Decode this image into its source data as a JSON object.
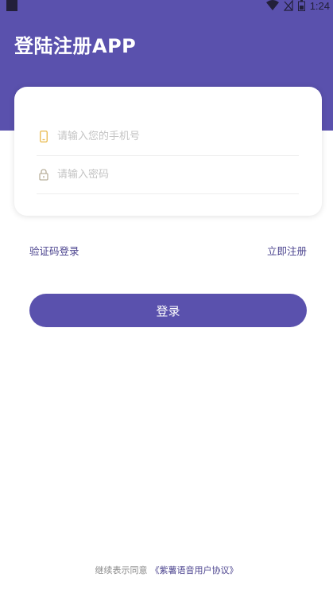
{
  "status_bar": {
    "time": "1:24",
    "icons": [
      "app-square-icon",
      "wifi-icon",
      "no-signal-icon",
      "battery-icon"
    ]
  },
  "header": {
    "title": "登陆注册APP"
  },
  "form": {
    "phone": {
      "placeholder": "请输入您的手机号",
      "value": "",
      "icon": "phone-icon"
    },
    "password": {
      "placeholder": "请输入密码",
      "value": "",
      "icon": "lock-icon"
    }
  },
  "links": {
    "sms_login": "验证码登录",
    "register": "立即注册"
  },
  "login_button": "登录",
  "footer": {
    "text": "继续表示同意",
    "agreement": "《紫薯语音用户协议》"
  },
  "colors": {
    "primary": "#5a51ad",
    "link": "#4b438e",
    "phone_icon": "#e8b84a",
    "lock_icon": "#b9b09c",
    "placeholder": "#c4c4c4"
  }
}
